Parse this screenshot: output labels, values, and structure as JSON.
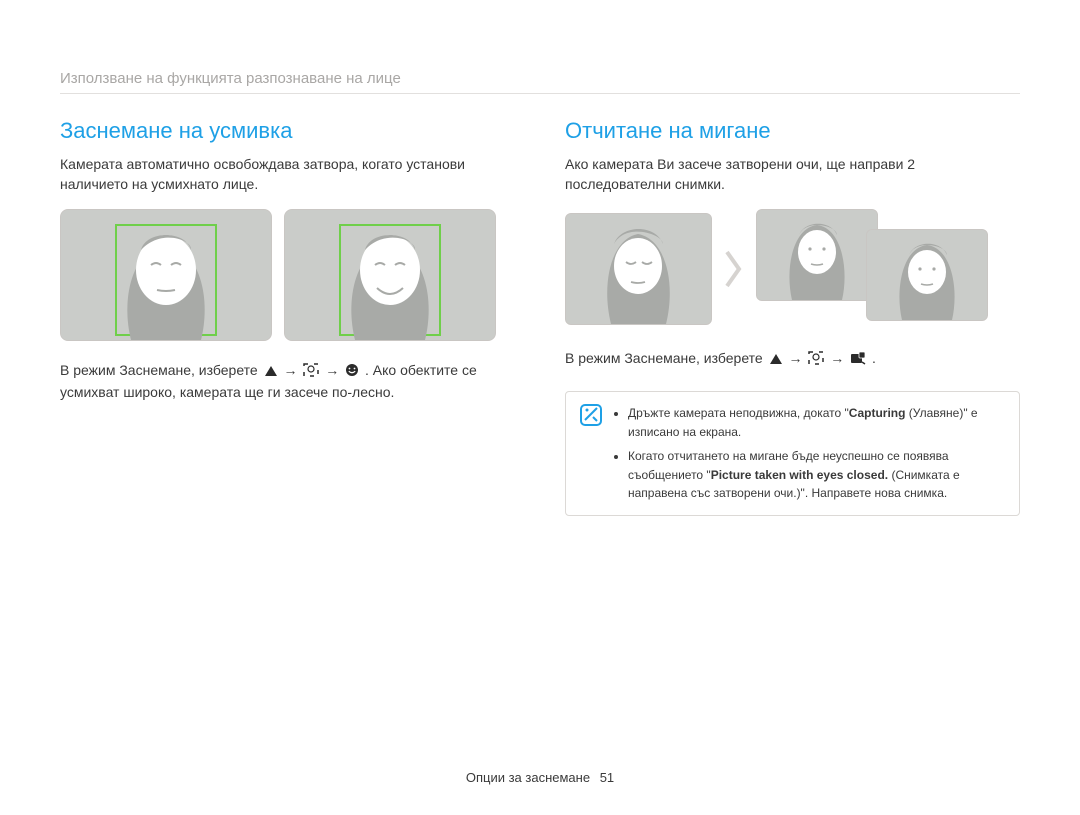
{
  "breadcrumb": "Използване на функцията разпознаване на лице",
  "left": {
    "title": "Заснемане на усмивка",
    "body": "Камерата автоматично освобождава затвора, когато установи наличието на усмихнато лице.",
    "caption_pre": "В режим Заснемане, изберете ",
    "caption_post": ". Ако обектите се усмихват широко, камерата ще ги засече по-лесно."
  },
  "right": {
    "title": "Отчитане на мигане",
    "body": "Ако камерата Ви засече затворени очи, ще направи 2 последователни снимки.",
    "caption_pre": "В режим Заснемане, изберете ",
    "caption_post": "."
  },
  "note": {
    "item1_pre": "Дръжте камерата неподвижна, докато \"",
    "item1_strong": "Capturing",
    "item1_post": " (Улавяне)\" е изписано на екрана.",
    "item2_pre": "Когато отчитането на мигане бъде неуспешно се появява съобщението \"",
    "item2_strong": "Picture taken with eyes closed.",
    "item2_post": " (Снимката е направена със затворени очи.)\". Направете нова снимка."
  },
  "footer": {
    "section": "Опции за заснемане",
    "page": "51"
  },
  "icons": {
    "arrow": "→"
  }
}
